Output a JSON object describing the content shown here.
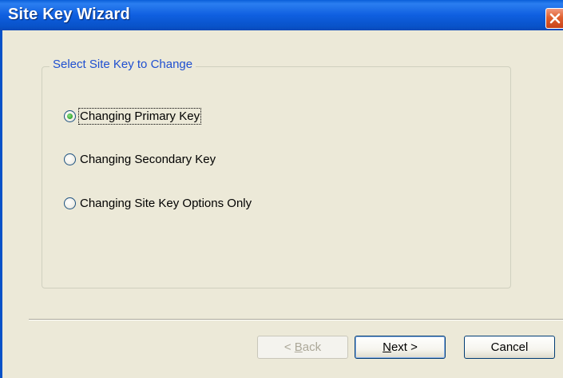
{
  "window": {
    "title": "Site Key Wizard"
  },
  "group": {
    "legend": "Select Site Key to Change"
  },
  "options": [
    {
      "label": "Changing Primary Key",
      "selected": true
    },
    {
      "label": "Changing Secondary Key",
      "selected": false
    },
    {
      "label": "Changing Site Key Options Only",
      "selected": false
    }
  ],
  "buttons": {
    "back": {
      "prefix": "< ",
      "mnemonic": "B",
      "rest": "ack",
      "enabled": false
    },
    "next": {
      "mnemonic": "N",
      "rest": "ext >",
      "enabled": true
    },
    "cancel": {
      "label": "Cancel"
    }
  },
  "colors": {
    "titlebar": "#0f5fe0",
    "legend_text": "#1f4fd0",
    "close_button": "#e0602e",
    "dialog_background": "#ece9d8"
  }
}
